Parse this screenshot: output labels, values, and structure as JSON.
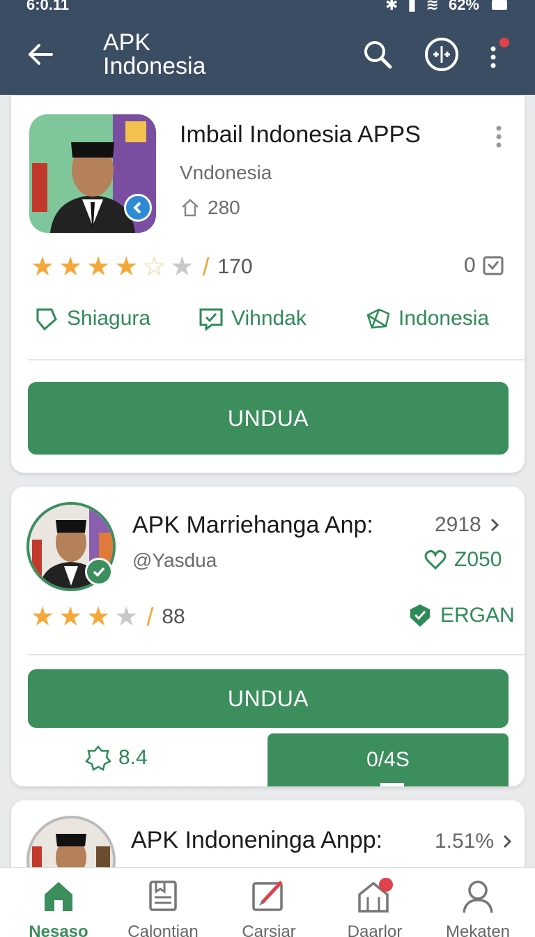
{
  "status": {
    "time": "6:0.11",
    "battery": "62%"
  },
  "appbar": {
    "title": "APK Indonesia"
  },
  "cards": [
    {
      "title": "Imbail Indonesia APPS",
      "subtitle": "Vndonesia",
      "installs": "280",
      "rating_count": "170",
      "right_count": "0",
      "tags": [
        "Shiagura",
        "Vihndak",
        "Indonesia"
      ],
      "button": "UNDUA"
    },
    {
      "title": "APK Marriehanga Anp:",
      "subtitle": "@Yasdua",
      "right_value": "2918",
      "likes": "Z050",
      "rating_count": "88",
      "badge_label": "ERGAN",
      "button": "UNDUA",
      "footer_left": "8.4",
      "footer_right": "0/4S"
    },
    {
      "title": "APK Indoneninga Anpp:",
      "right_value": "1.51%"
    }
  ],
  "nav": [
    {
      "label": "Nesaso",
      "icon": "home-icon",
      "active": true
    },
    {
      "label": "Calontian",
      "icon": "catalog-icon",
      "active": false
    },
    {
      "label": "Carsiar",
      "icon": "edit-icon",
      "active": false
    },
    {
      "label": "Daarlor",
      "icon": "store-icon",
      "active": false,
      "badge": "1"
    },
    {
      "label": "Mekaten",
      "icon": "profile-icon",
      "active": false
    }
  ],
  "colors": {
    "appbar": "#3a4d63",
    "accent": "#3c8e5d",
    "star": "#f4a83a"
  }
}
